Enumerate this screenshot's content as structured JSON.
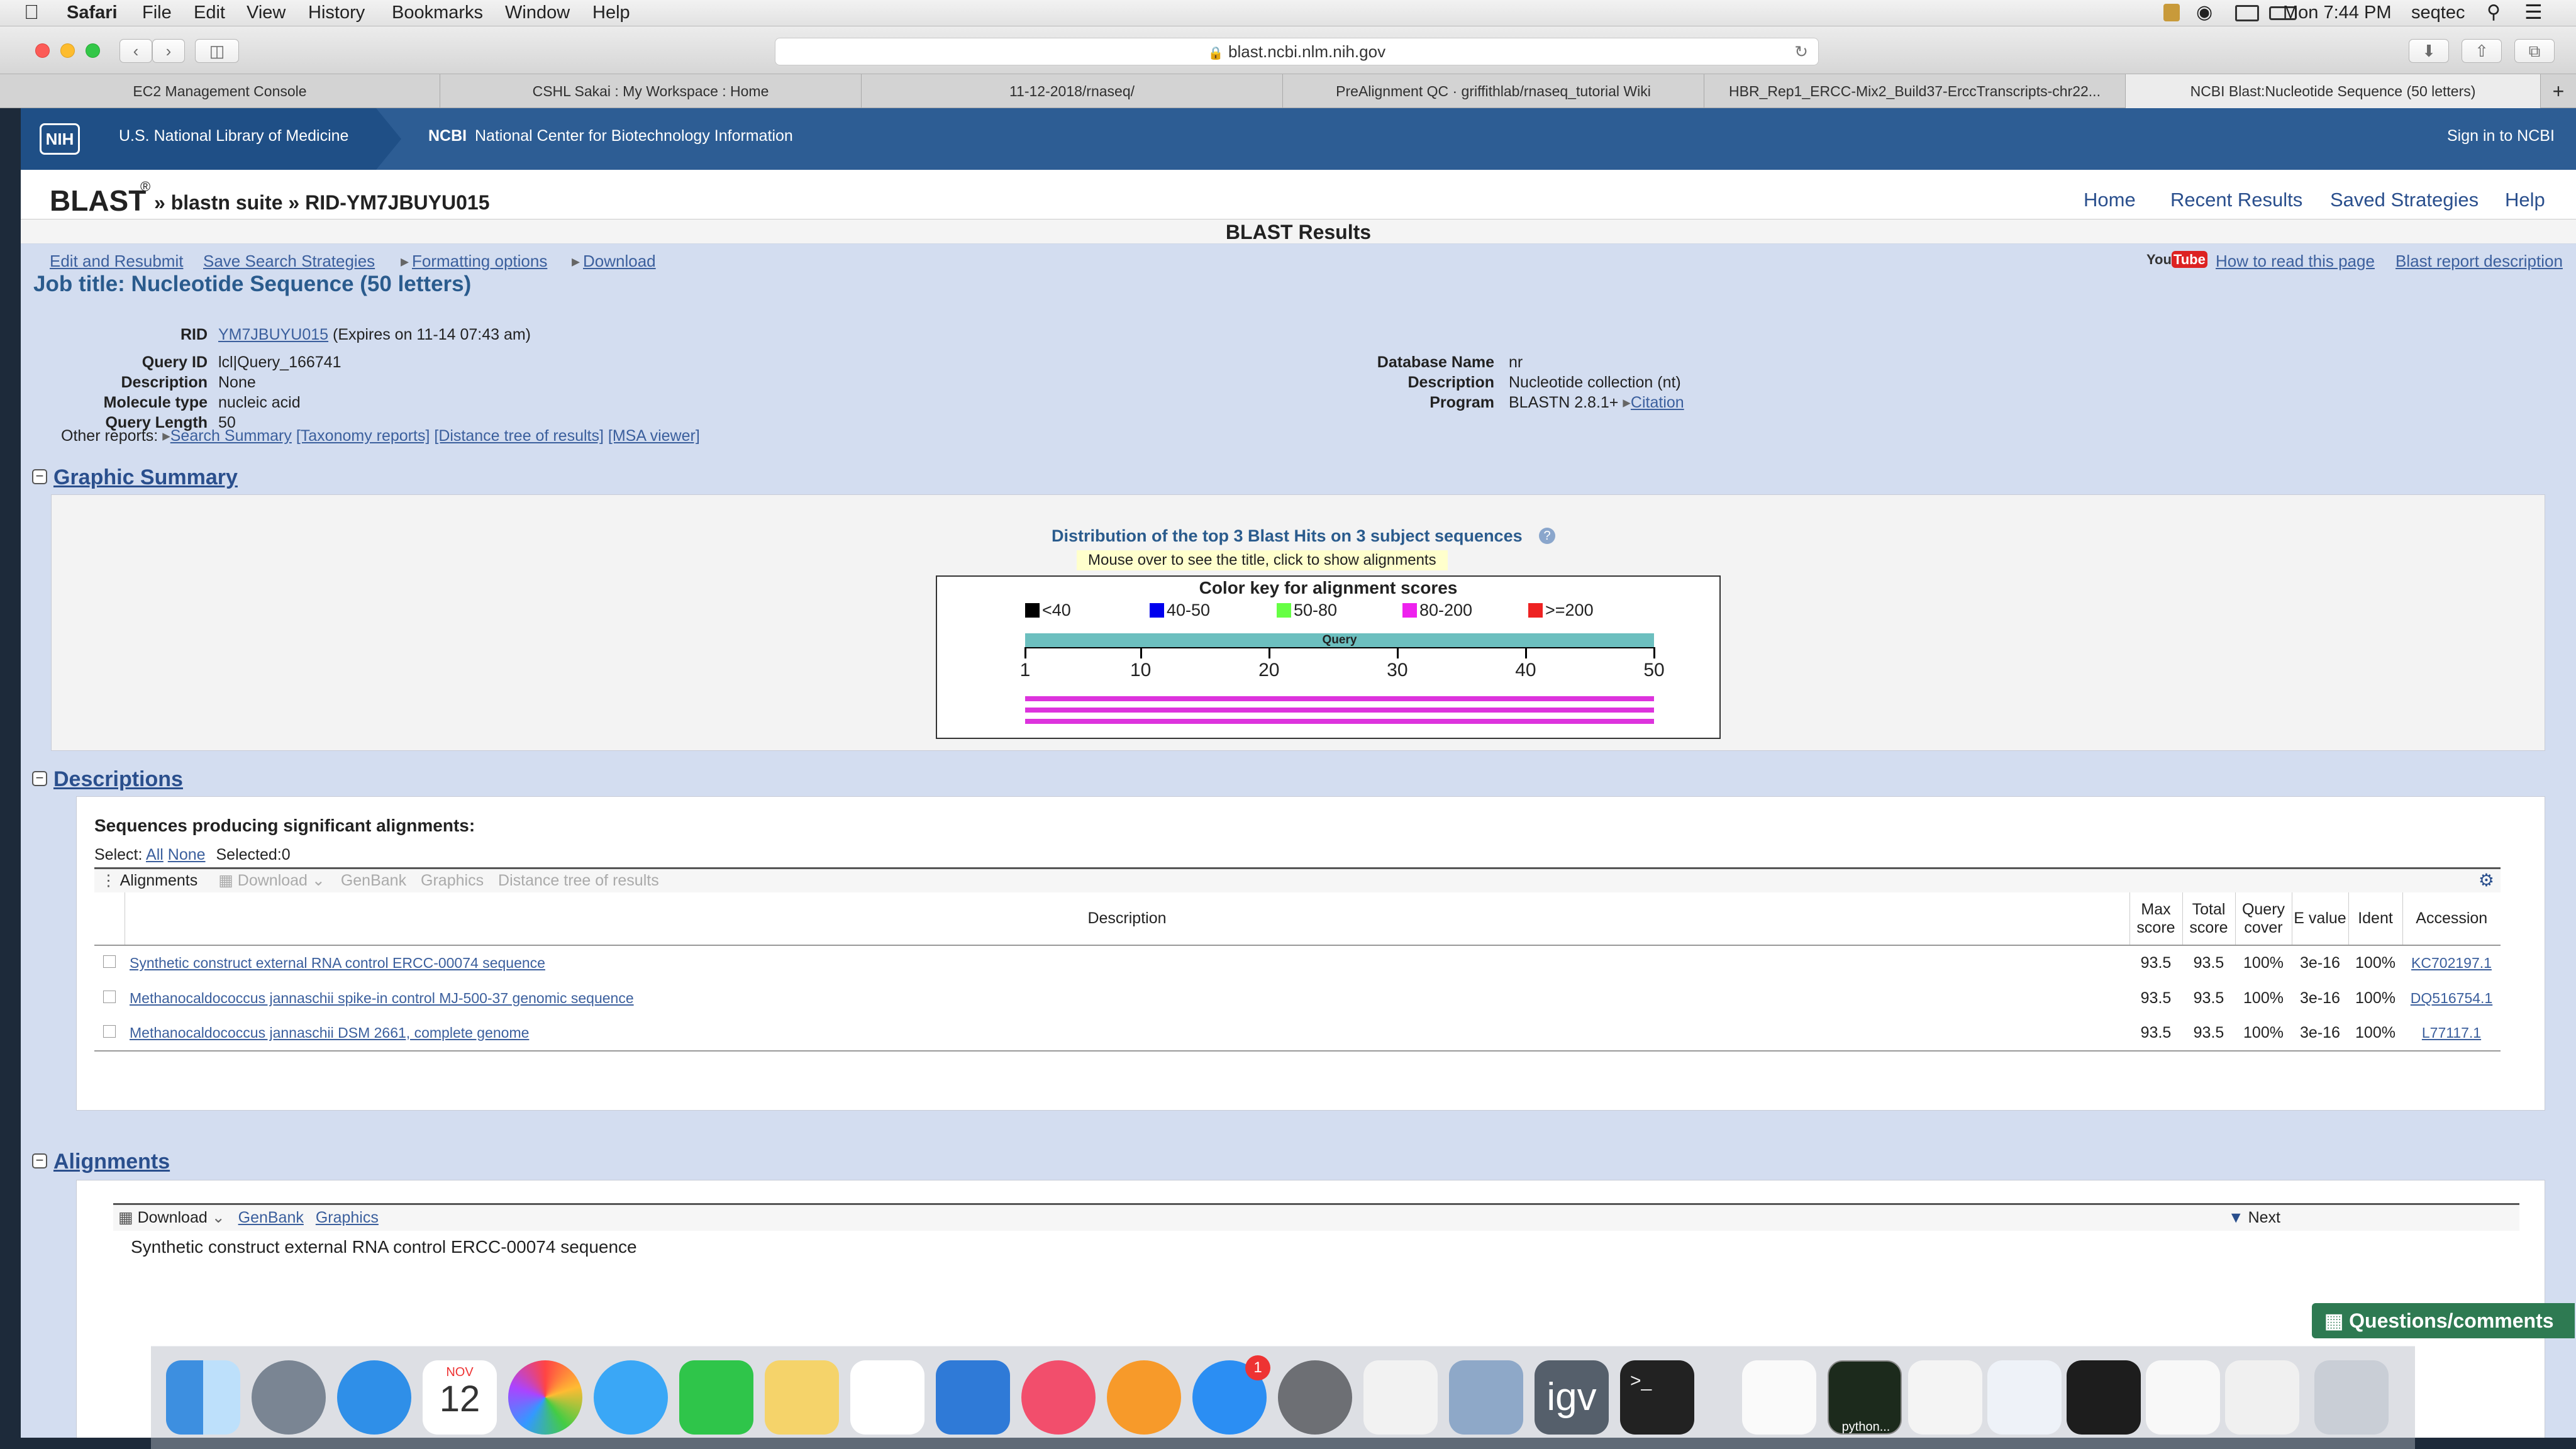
{
  "menubar": {
    "app": "Safari",
    "items": [
      "File",
      "Edit",
      "View",
      "History",
      "Bookmarks",
      "Window",
      "Help"
    ],
    "clock": "Mon 7:44 PM",
    "user": "seqtec"
  },
  "address": "blast.ncbi.nlm.nih.gov",
  "tabs": [
    "EC2 Management Console",
    "CSHL Sakai : My Workspace : Home",
    "11-12-2018/rnaseq/",
    "PreAlignment QC · griffithlab/rnaseq_tutorial Wiki",
    "HBR_Rep1_ERCC-Mix2_Build37-ErccTranscripts-chr22...",
    "NCBI Blast:Nucleotide Sequence (50 letters)"
  ],
  "ncbi": {
    "nih_logo": "NIH",
    "nlm": "U.S. National Library of Medicine",
    "ncbi_abbr": "NCBI",
    "ncbi_full": "National Center for Biotechnology Information",
    "signin": "Sign in to NCBI"
  },
  "blastnav": {
    "blast": "BLAST",
    "reg": "®",
    "crumb": "» blastn suite » RID-YM7JBUYU015",
    "links": [
      "Home",
      "Recent Results",
      "Saved Strategies",
      "Help"
    ]
  },
  "results_title": "BLAST Results",
  "actions": {
    "edit": "Edit and Resubmit",
    "save": "Save Search Strategies",
    "format": "Formatting options",
    "download": "Download",
    "youtube": "YouTube",
    "howto": "How to read this page",
    "report": "Blast report description"
  },
  "job_title": "Job title: Nucleotide Sequence (50 letters)",
  "info": {
    "rid_label": "RID",
    "rid": "YM7JBUYU015",
    "rid_exp": "(Expires on 11-14 07:43 am)",
    "qid_label": "Query ID",
    "qid": "lcl|Query_166741",
    "desc_label": "Description",
    "desc": "None",
    "mol_label": "Molecule type",
    "mol": "nucleic acid",
    "len_label": "Query Length",
    "len": "50",
    "db_label": "Database Name",
    "db": "nr",
    "dbdesc_label": "Description",
    "dbdesc": "Nucleotide collection (nt)",
    "prog_label": "Program",
    "prog": "BLASTN 2.8.1+",
    "citation": "Citation"
  },
  "other": {
    "label": "Other reports:",
    "links": [
      "Search Summary",
      "[Taxonomy reports]",
      "[Distance tree of results]",
      "[MSA viewer]"
    ]
  },
  "graphic": {
    "section": "Graphic Summary",
    "dist_title": "Distribution of the top 3 Blast Hits on 3 subject sequences",
    "mouseover": "Mouse over to see the title, click to show alignments",
    "key_title": "Color key for alignment scores",
    "keys": [
      {
        "label": "<40",
        "color": "#000000"
      },
      {
        "label": "40-50",
        "color": "#0000ee"
      },
      {
        "label": "50-80",
        "color": "#66ff44"
      },
      {
        "label": "80-200",
        "color": "#ee22ee"
      },
      {
        "label": ">=200",
        "color": "#ee2222"
      }
    ],
    "query_label": "Query",
    "ticks": [
      "1",
      "10",
      "20",
      "30",
      "40",
      "50"
    ],
    "hits": [
      {
        "start": 1,
        "end": 50,
        "color": "#dd33dd"
      },
      {
        "start": 1,
        "end": 50,
        "color": "#dd33dd"
      },
      {
        "start": 1,
        "end": 50,
        "color": "#dd33dd"
      }
    ]
  },
  "descriptions": {
    "section": "Descriptions",
    "heading": "Sequences producing significant alignments:",
    "select_label": "Select:",
    "all": "All",
    "none": "None",
    "selected": "Selected:0",
    "toolbar": [
      "Alignments",
      "Download",
      "GenBank",
      "Graphics",
      "Distance tree of results"
    ],
    "columns": [
      "Description",
      "Max score",
      "Total score",
      "Query cover",
      "E value",
      "Ident",
      "Accession"
    ],
    "rows": [
      {
        "desc": "Synthetic construct external RNA control ERCC-00074 sequence",
        "max": "93.5",
        "total": "93.5",
        "cover": "100%",
        "e": "3e-16",
        "ident": "100%",
        "acc": "KC702197.1"
      },
      {
        "desc": "Methanocaldococcus jannaschii spike-in control MJ-500-37 genomic sequence",
        "max": "93.5",
        "total": "93.5",
        "cover": "100%",
        "e": "3e-16",
        "ident": "100%",
        "acc": "DQ516754.1"
      },
      {
        "desc": "Methanocaldococcus jannaschii DSM 2661, complete genome",
        "max": "93.5",
        "total": "93.5",
        "cover": "100%",
        "e": "3e-16",
        "ident": "100%",
        "acc": "L77117.1"
      }
    ]
  },
  "alignments": {
    "section": "Alignments",
    "download": "Download",
    "genbank": "GenBank",
    "graphics": "Graphics",
    "next": "Next",
    "first_title": "Synthetic construct external RNA control ERCC-00074 sequence"
  },
  "questions": "Questions/comments",
  "dock": {
    "cal_month": "NOV",
    "cal_day": "12",
    "badge": "1",
    "igv": "igv",
    "python": "python..."
  }
}
